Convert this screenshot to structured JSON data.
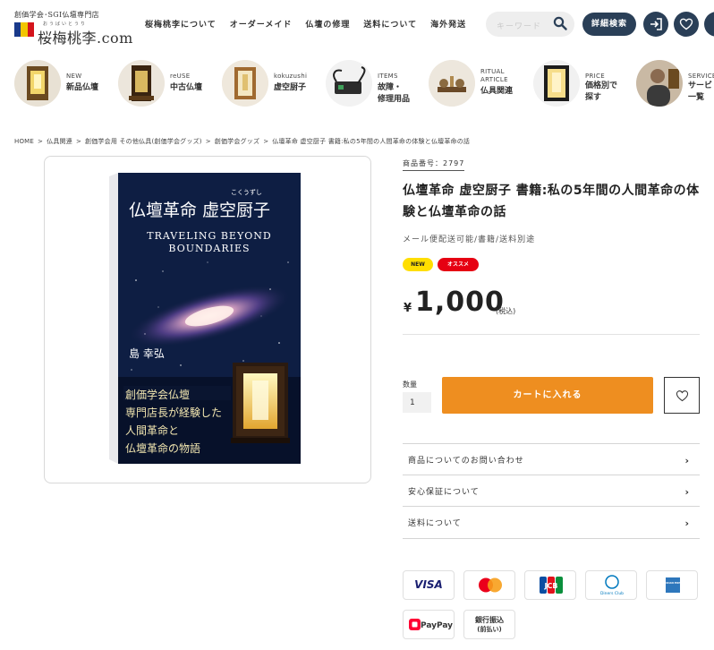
{
  "header": {
    "logo_tag": "創価学会･SGI仏壇専門店",
    "logo_ruby": "おうばいとうり",
    "logo_name": "桜梅桃李.com",
    "nav": [
      "桜梅桃李について",
      "オーダーメイド",
      "仏壇の修理",
      "送料について",
      "海外発送"
    ],
    "search_placeholder": "キーワード",
    "advanced_search": "詳細検索"
  },
  "categories": [
    {
      "en": "NEW",
      "ja": "新品仏壇"
    },
    {
      "en": "reUSE",
      "ja": "中古仏壇"
    },
    {
      "en": "kokuzushi",
      "ja": "虚空厨子"
    },
    {
      "en": "ITEMS",
      "ja": "故障・\n修理用品"
    },
    {
      "en": "RITUAL\nARTICLE",
      "ja": "仏具関連"
    },
    {
      "en": "PRICE",
      "ja": "価格別で\n探す"
    },
    {
      "en": "SERVICE",
      "ja": "サービ\n一覧"
    }
  ],
  "breadcrumb": [
    "HOME",
    ">",
    "仏具関連",
    ">",
    "創価学会用 その他仏具(創価学会グッズ)",
    ">",
    "創価学会グッズ",
    ">",
    "仏壇革命 虚空厨子 書籍:私の5年間の人間革命の体験と仏壇革命の話"
  ],
  "book": {
    "title_main": "仏壇革命 虚空厨子",
    "title_ruby": "こくうずし",
    "subtitle_1": "TRAVELING BEYOND",
    "subtitle_2": "BOUNDARIES",
    "author": "島 幸弘",
    "band": [
      "創価学会仏壇",
      "専門店長が経験した",
      "人間革命と",
      "仏壇革命の物語"
    ]
  },
  "product": {
    "sku": "商品番号：2797",
    "title": "仏壇革命 虚空厨子 書籍:私の5年間の人間革命の体験と仏壇革命の話",
    "note": "メール便配送可能/書籍/送料別途",
    "badge_new": "NEW",
    "badge_recommend": "オススメ",
    "price_symbol": "¥",
    "price": "1,000",
    "tax": "(税込)",
    "qty_label": "数量",
    "qty_value": "1",
    "cart_button": "カートに入れる"
  },
  "accordion": [
    "商品についてのお問い合わせ",
    "安心保証について",
    "送料について"
  ],
  "payments": {
    "visa": "VISA",
    "jcb": "JCB",
    "diners": "Diners Club",
    "amex": "AMERICAN EXPRESS",
    "paypay": "PayPay",
    "bank_1": "銀行振込",
    "bank_2": "(前払い)"
  },
  "colors": {
    "navy": "#2a3f57",
    "cart_orange": "#ee8e20",
    "badge_yellow": "#ffde00",
    "badge_red": "#e60012"
  }
}
